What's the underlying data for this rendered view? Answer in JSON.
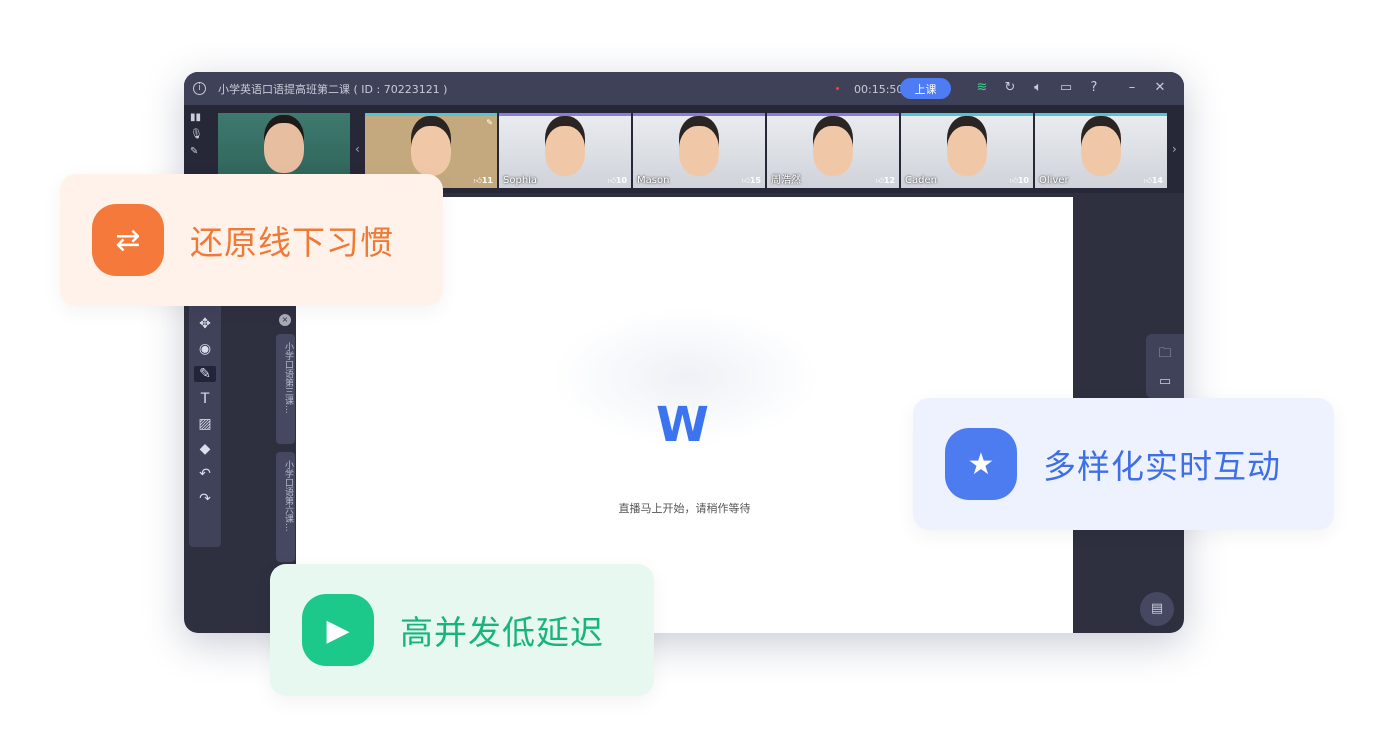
{
  "window": {
    "title": "小学英语口语提高班第二课 ( ID : 70223121 )",
    "timer": "00:15:50",
    "start_button": "上课"
  },
  "teacher": {
    "mic": "🎙"
  },
  "students": [
    {
      "name": "",
      "likes": "11"
    },
    {
      "name": "Sophia",
      "likes": "10"
    },
    {
      "name": "Mason",
      "likes": "15"
    },
    {
      "name": "周浩然",
      "likes": "12"
    },
    {
      "name": "Caden",
      "likes": "10"
    },
    {
      "name": "Oliver",
      "likes": "14"
    }
  ],
  "courseware_tabs": [
    "小学口语第三课...",
    "小学口语第六课..."
  ],
  "canvas": {
    "logo": "W",
    "waiting_text": "直播马上开始，请稍作等待"
  },
  "features": [
    {
      "label": "还原线下习惯",
      "color": "#f5793a",
      "bg": "#fff2ea",
      "text": "#f07a35"
    },
    {
      "label": "多样化实时互动",
      "color": "#4c7cf0",
      "bg": "#edf2fe",
      "text": "#3f6fe6"
    },
    {
      "label": "高并发低延迟",
      "color": "#1cc98a",
      "bg": "#e7f8f1",
      "text": "#17b57b"
    }
  ]
}
